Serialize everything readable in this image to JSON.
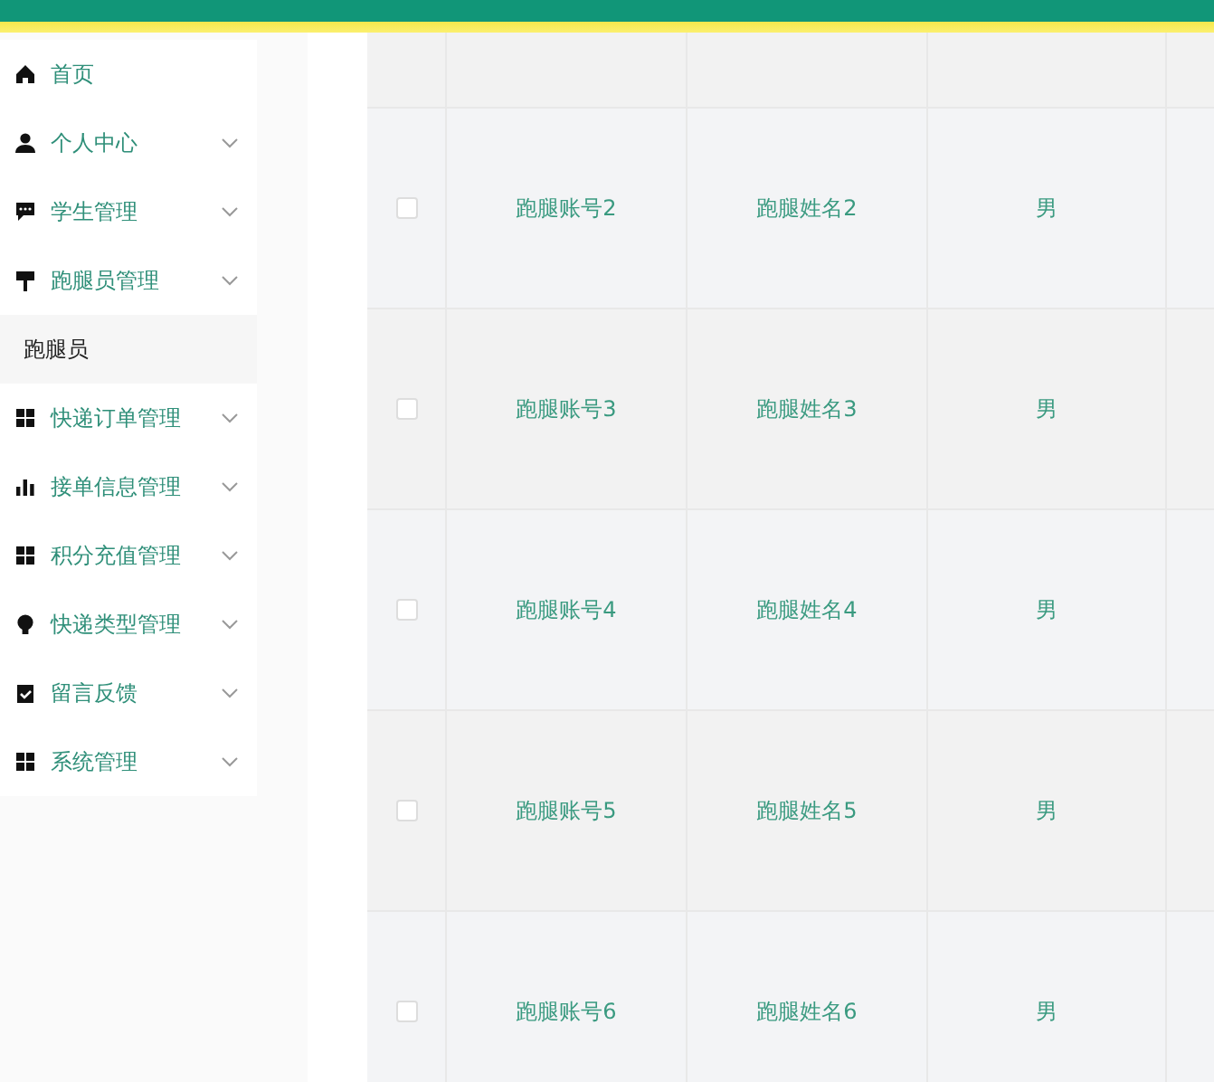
{
  "sidebar": {
    "items": [
      {
        "label": "首页",
        "kind": "link"
      },
      {
        "label": "个人中心",
        "kind": "submenu"
      },
      {
        "label": "学生管理",
        "kind": "submenu"
      },
      {
        "label": "跑腿员管理",
        "kind": "submenu",
        "children": [
          {
            "label": "跑腿员"
          }
        ]
      },
      {
        "label": "快递订单管理",
        "kind": "submenu"
      },
      {
        "label": "接单信息管理",
        "kind": "submenu"
      },
      {
        "label": "积分充值管理",
        "kind": "submenu"
      },
      {
        "label": "快递类型管理",
        "kind": "submenu"
      },
      {
        "label": "留言反馈",
        "kind": "submenu"
      },
      {
        "label": "系统管理",
        "kind": "submenu"
      }
    ]
  },
  "table": {
    "rows": [
      {
        "checked": false,
        "account": "跑腿账号2",
        "name": "跑腿姓名2",
        "gender": "男"
      },
      {
        "checked": false,
        "account": "跑腿账号3",
        "name": "跑腿姓名3",
        "gender": "男"
      },
      {
        "checked": false,
        "account": "跑腿账号4",
        "name": "跑腿姓名4",
        "gender": "男"
      },
      {
        "checked": false,
        "account": "跑腿账号5",
        "name": "跑腿姓名5",
        "gender": "男"
      },
      {
        "checked": false,
        "account": "跑腿账号6",
        "name": "跑腿姓名6",
        "gender": "男"
      }
    ]
  }
}
